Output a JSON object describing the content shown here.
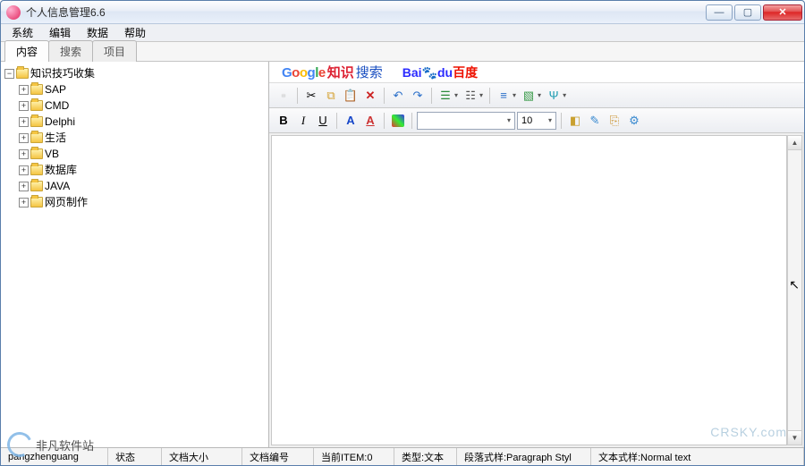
{
  "title": "个人信息管理6.6",
  "menus": [
    "系统",
    "编辑",
    "数据",
    "帮助"
  ],
  "tabs": [
    {
      "label": "内容",
      "active": true
    },
    {
      "label": "搜索",
      "active": false
    },
    {
      "label": "项目",
      "active": false
    }
  ],
  "tree": {
    "root": {
      "label": "知识技巧收集",
      "expanded": true
    },
    "children": [
      {
        "label": "SAP"
      },
      {
        "label": "CMD"
      },
      {
        "label": "Delphi"
      },
      {
        "label": "生活"
      },
      {
        "label": "VB"
      },
      {
        "label": "数据库"
      },
      {
        "label": "JAVA"
      },
      {
        "label": "网页制作"
      }
    ]
  },
  "head": {
    "knowledge": "知识",
    "search": "搜索",
    "baidu1": "Bai",
    "baidu2": "百度"
  },
  "format": {
    "font_value": "",
    "size_value": "10"
  },
  "status": {
    "author": "pangzhenguang",
    "state_label": "状态",
    "docsize_label": "文档大小",
    "docno_label": "文档编号",
    "curitem": "当前ITEM:0",
    "type": "类型:文本",
    "para": "段落式样:Paragraph Styl",
    "text": "文本式样:Normal text"
  },
  "watermark": "非凡软件站",
  "cr": "CRSKY.com"
}
